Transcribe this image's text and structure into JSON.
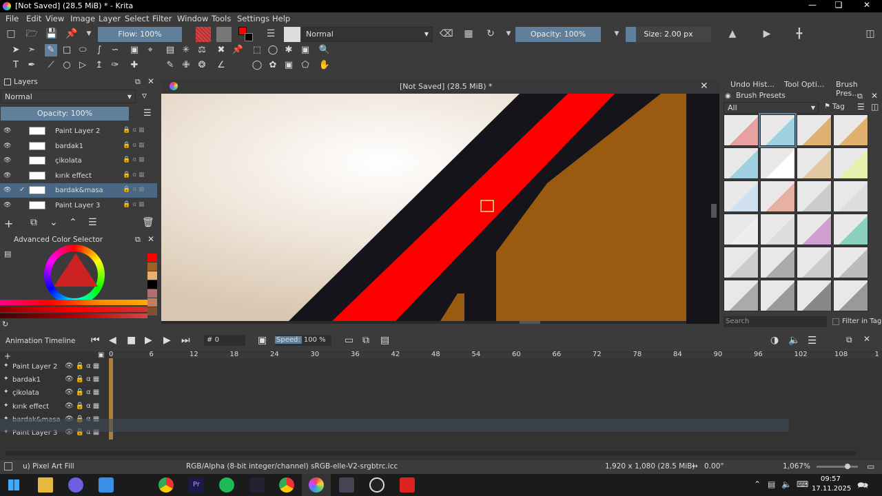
{
  "window": {
    "title": "[Not Saved]  (28.5 MiB) * - Krita"
  },
  "menu": [
    "File",
    "Edit",
    "View",
    "Image",
    "Layer",
    "Select",
    "Filter",
    "Window",
    "Tools",
    "Settings",
    "Help"
  ],
  "toolbar": {
    "flow": "Flow: 100%",
    "blend_mode": "Normal",
    "opacity": "Opacity: 100%",
    "size": "Size: 2.00 px"
  },
  "layers_panel": {
    "title": "Layers",
    "blend_mode": "Normal",
    "opacity": "Opacity:  100%",
    "layers": [
      {
        "name": "Paint Layer 2",
        "selected": false
      },
      {
        "name": "bardak1",
        "selected": false
      },
      {
        "name": "çikolata",
        "selected": false
      },
      {
        "name": "kırık effect",
        "selected": false
      },
      {
        "name": "bardak&masa",
        "selected": true
      },
      {
        "name": "Paint Layer 3",
        "selected": false
      }
    ]
  },
  "color_selector": {
    "title": "Advanced Color Selector"
  },
  "canvas": {
    "title": "[Not Saved]  (28.5 MiB) *"
  },
  "right_dock": {
    "tabs": [
      "Undo Hist...",
      "Tool Opti...",
      "Brush Pres..."
    ],
    "panel_title": "Brush Presets",
    "filter": "All",
    "tag_label": "Tag",
    "search_placeholder": "Search",
    "filter_in_tag": "Filter in Tag"
  },
  "timeline": {
    "title": "Animation Timeline",
    "frame": "0",
    "speed_label": "Speed:",
    "speed_value": "100 %",
    "ruler": [
      "0",
      "6",
      "12",
      "18",
      "24",
      "30",
      "36",
      "42",
      "48",
      "54",
      "60",
      "66",
      "72",
      "78",
      "84",
      "90",
      "96",
      "102",
      "108",
      "1"
    ],
    "layers": [
      "Paint Layer 2",
      "bardak1",
      "çikolata",
      "kırık effect",
      "bardak&masa",
      "Paint Layer 3"
    ]
  },
  "status": {
    "tool": "u) Pixel Art Fill",
    "color_info": "RGB/Alpha (8-bit integer/channel)  sRGB-elle-V2-srgbtrc.icc",
    "size": "1,920 x 1,080 (28.5 MiB)",
    "rotation": "0.00°",
    "zoom": "1,067%"
  },
  "taskbar": {
    "time": "09:57",
    "date": "17.11.2025"
  },
  "colors": {
    "red": "#ff0000",
    "brown": "#9a5a10",
    "dark": "#15141b",
    "accent": "#5f7f9a"
  }
}
